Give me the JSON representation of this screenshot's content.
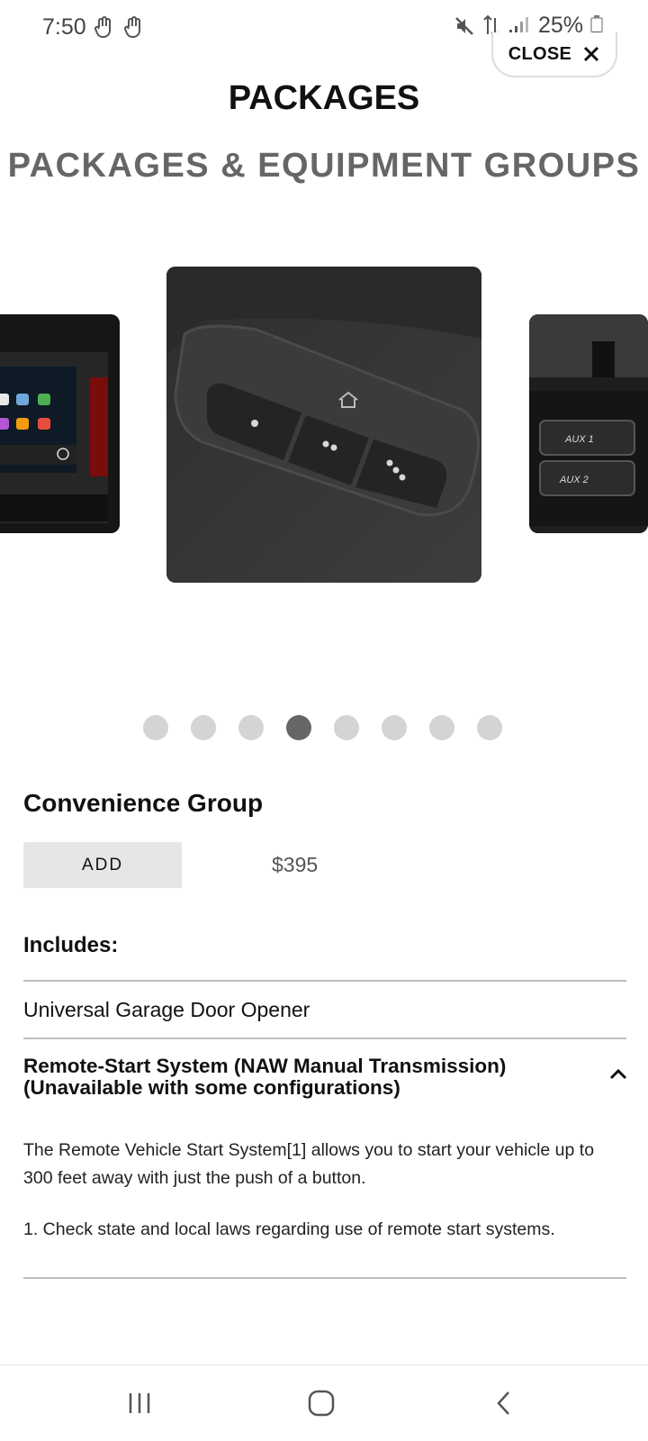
{
  "status": {
    "time": "7:50",
    "battery": "25%",
    "icons": [
      "gesture-icon",
      "gesture-icon",
      "mute-icon",
      "data-transfer-icon",
      "signal-icon",
      "battery-icon"
    ]
  },
  "header": {
    "close_label": "CLOSE",
    "title": "PACKAGES",
    "subtitle": "PACKAGES & EQUIPMENT GROUPS"
  },
  "carousel": {
    "slides": [
      {
        "name": "infotainment-screen"
      },
      {
        "name": "garage-door-opener-buttons"
      },
      {
        "name": "aux-switches"
      }
    ],
    "dots_count": 8,
    "active_index": 3
  },
  "package": {
    "name": "Convenience Group",
    "add_label": "ADD",
    "price": "$395",
    "includes_label": "Includes:",
    "items": [
      {
        "title": "Universal Garage Door Opener"
      },
      {
        "title_line1": "Remote-Start System (NAW Manual Transmission)",
        "title_line2": "(Unavailable with some configurations)",
        "description": "The Remote Vehicle Start System[1] allows you to start your vehicle up to 300 feet away with just the push of a button.",
        "footnote": "1. Check state and local laws regarding use of remote start systems."
      }
    ]
  },
  "colors": {
    "active_dot": "#666666",
    "inactive_dot": "#d4d4d4",
    "add_button_bg": "#e6e6e6",
    "subtitle": "#666666"
  }
}
